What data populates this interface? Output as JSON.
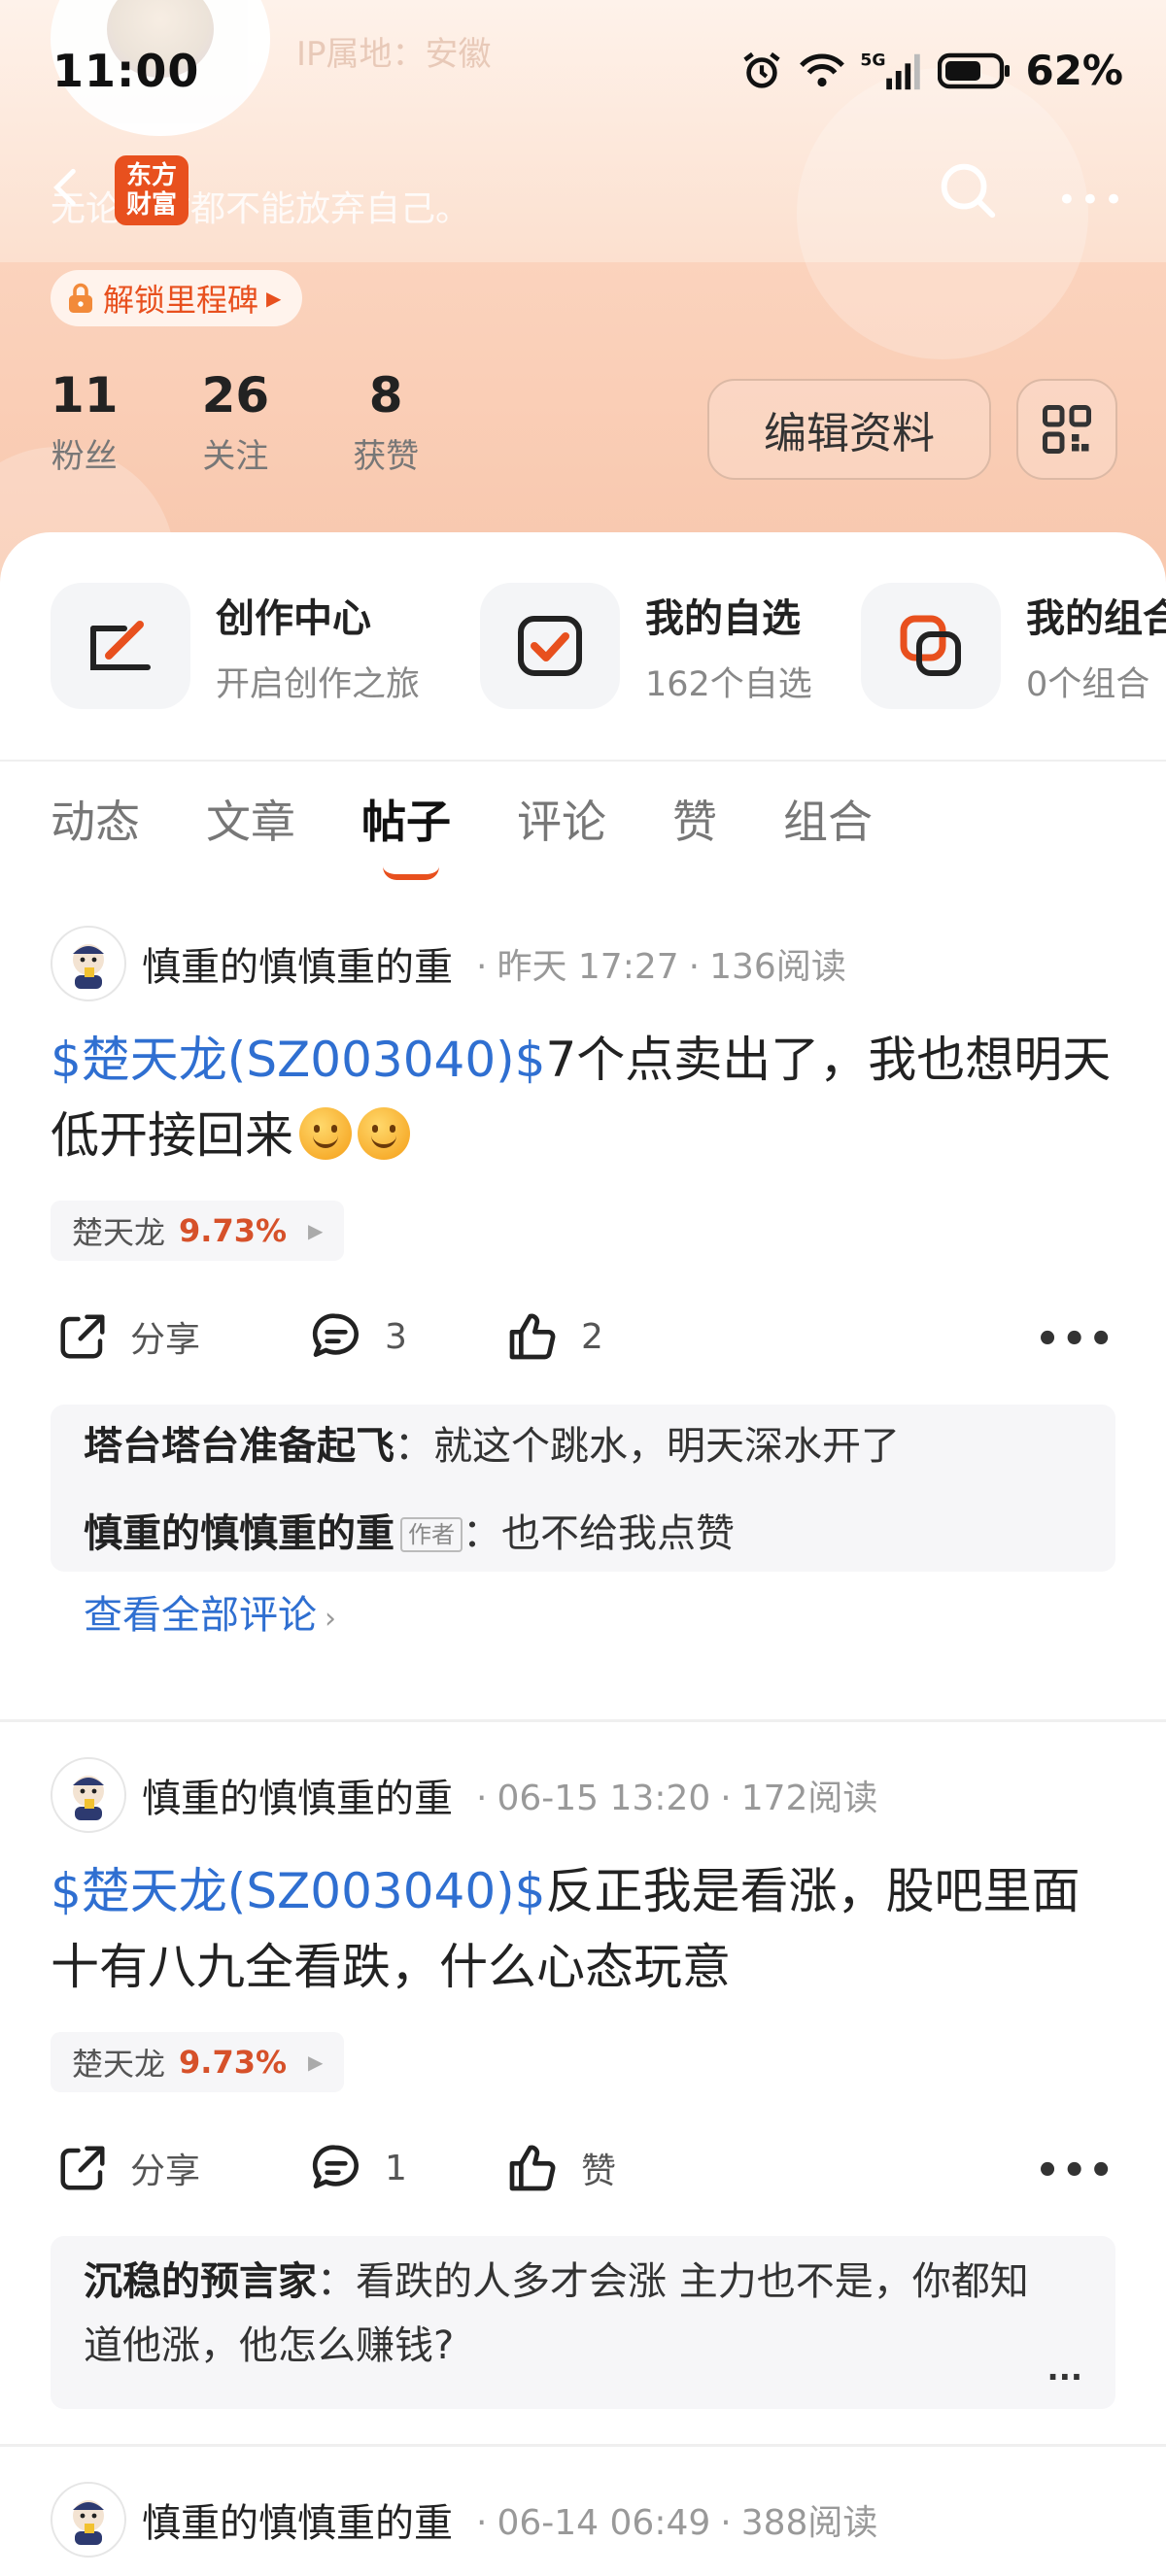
{
  "status_bar": {
    "time": "11:00",
    "battery": "62%",
    "ip_location": "IP属地：安徽"
  },
  "header": {
    "brand": "东方财富",
    "motto": "无论何时都不能放弃自己。",
    "milestone_label": "解锁里程碑",
    "stats": [
      {
        "num": "11",
        "label": "粉丝"
      },
      {
        "num": "26",
        "label": "关注"
      },
      {
        "num": "8",
        "label": "获赞"
      }
    ],
    "edit_label": "编辑资料"
  },
  "shortcuts": [
    {
      "title": "创作中心",
      "sub": "开启创作之旅",
      "icon": "pen-board-icon"
    },
    {
      "title": "我的自选",
      "sub": "162个自选",
      "icon": "checkbox-icon"
    },
    {
      "title": "我的组合",
      "sub": "0个组合",
      "icon": "portfolio-icon"
    }
  ],
  "tabs": [
    "动态",
    "文章",
    "帖子",
    "评论",
    "赞",
    "组合"
  ],
  "active_tab": "帖子",
  "posts": [
    {
      "author": "慎重的慎慎重的重",
      "time": "昨天 17:27",
      "reads": "136阅读",
      "stock_link": "$楚天龙(SZ003040)$",
      "text": "7个点卖出了，我也想明天低开接回来",
      "stock_name": "楚天龙",
      "stock_pct": "9.73%",
      "share_label": "分享",
      "comment_count": "3",
      "like_count": "2",
      "comments": [
        {
          "name": "塔台塔台准备起飞",
          "text": "就这个跳水，明天深水开了",
          "is_author": false
        },
        {
          "name": "慎重的慎慎重的重",
          "text": "也不给我点赞",
          "is_author": true
        }
      ],
      "author_badge": "作者",
      "view_all": "查看全部评论"
    },
    {
      "author": "慎重的慎慎重的重",
      "time": "06-15 13:20",
      "reads": "172阅读",
      "stock_link": "$楚天龙(SZ003040)$",
      "text": "反正我是看涨，股吧里面十有八九全看跌，什么心态玩意",
      "stock_name": "楚天龙",
      "stock_pct": "9.73%",
      "share_label": "分享",
      "comment_count": "1",
      "like_label": "赞",
      "comments": [
        {
          "name": "沉稳的预言家",
          "text": "看跌的人多才会涨 主力也不是，你都知道他涨，他怎么赚钱?"
        }
      ],
      "ellipsis": "..."
    },
    {
      "author": "慎重的慎慎重的重",
      "time": "06-14 06:49",
      "reads": "388阅读"
    }
  ],
  "colors": {
    "accent": "#e8501e",
    "link": "#2f6fd1",
    "rise": "#d6512a"
  }
}
